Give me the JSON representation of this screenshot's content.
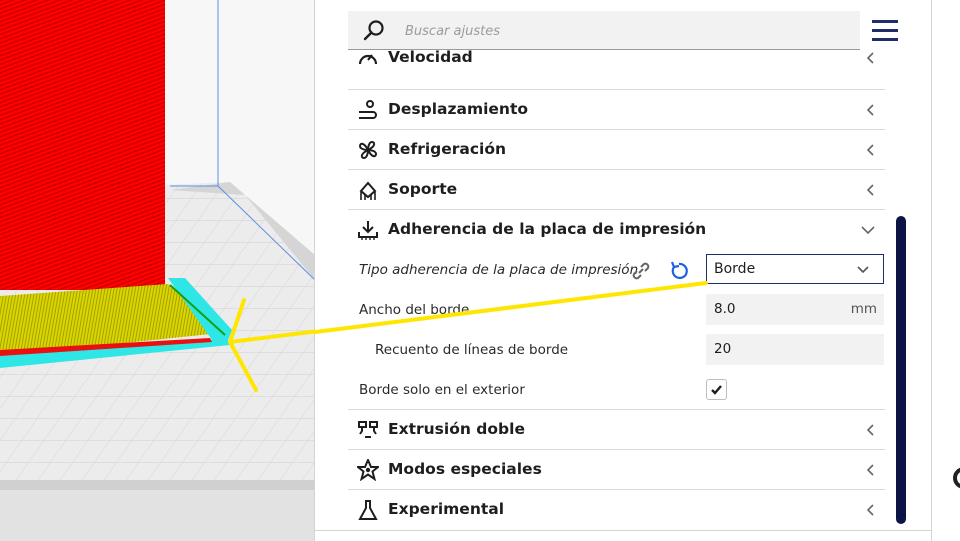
{
  "search": {
    "placeholder": "Buscar ajustes",
    "icon": "search-icon"
  },
  "menu": {
    "icon": "hamburger-menu-icon"
  },
  "categories_top": [
    {
      "label": "Velocidad",
      "icon": "speed-icon",
      "expanded": false
    },
    {
      "label": "Desplazamiento",
      "icon": "travel-icon",
      "expanded": false
    },
    {
      "label": "Refrigeración",
      "icon": "fan-icon",
      "expanded": false
    },
    {
      "label": "Soporte",
      "icon": "support-icon",
      "expanded": false
    },
    {
      "label": "Adherencia de la placa de impresión",
      "icon": "adhesion-icon",
      "expanded": true
    }
  ],
  "adhesion_settings": {
    "type": {
      "label": "Tipo adherencia de la placa de impresión",
      "value": "Borde",
      "icons": [
        "link-icon",
        "reset-icon"
      ]
    },
    "brim_width": {
      "label": "Ancho del borde",
      "value": "8.0",
      "unit": "mm"
    },
    "brim_line_count": {
      "label": "Recuento de líneas de borde",
      "value": "20"
    },
    "brim_outside_only": {
      "label": "Borde solo en el exterior",
      "checked": true
    }
  },
  "categories_bottom": [
    {
      "label": "Extrusión doble",
      "icon": "dual-extrusion-icon",
      "expanded": false
    },
    {
      "label": "Modos especiales",
      "icon": "special-modes-icon",
      "expanded": false
    },
    {
      "label": "Experimental",
      "icon": "flask-icon",
      "expanded": false
    }
  ],
  "colors": {
    "model": "#ff0000",
    "brim_top": "#d7d400",
    "brim_side": "#2ee6e6",
    "annotation": "#ffe600",
    "scrollbar": "#0c1446",
    "accent": "#1f2d6b"
  }
}
